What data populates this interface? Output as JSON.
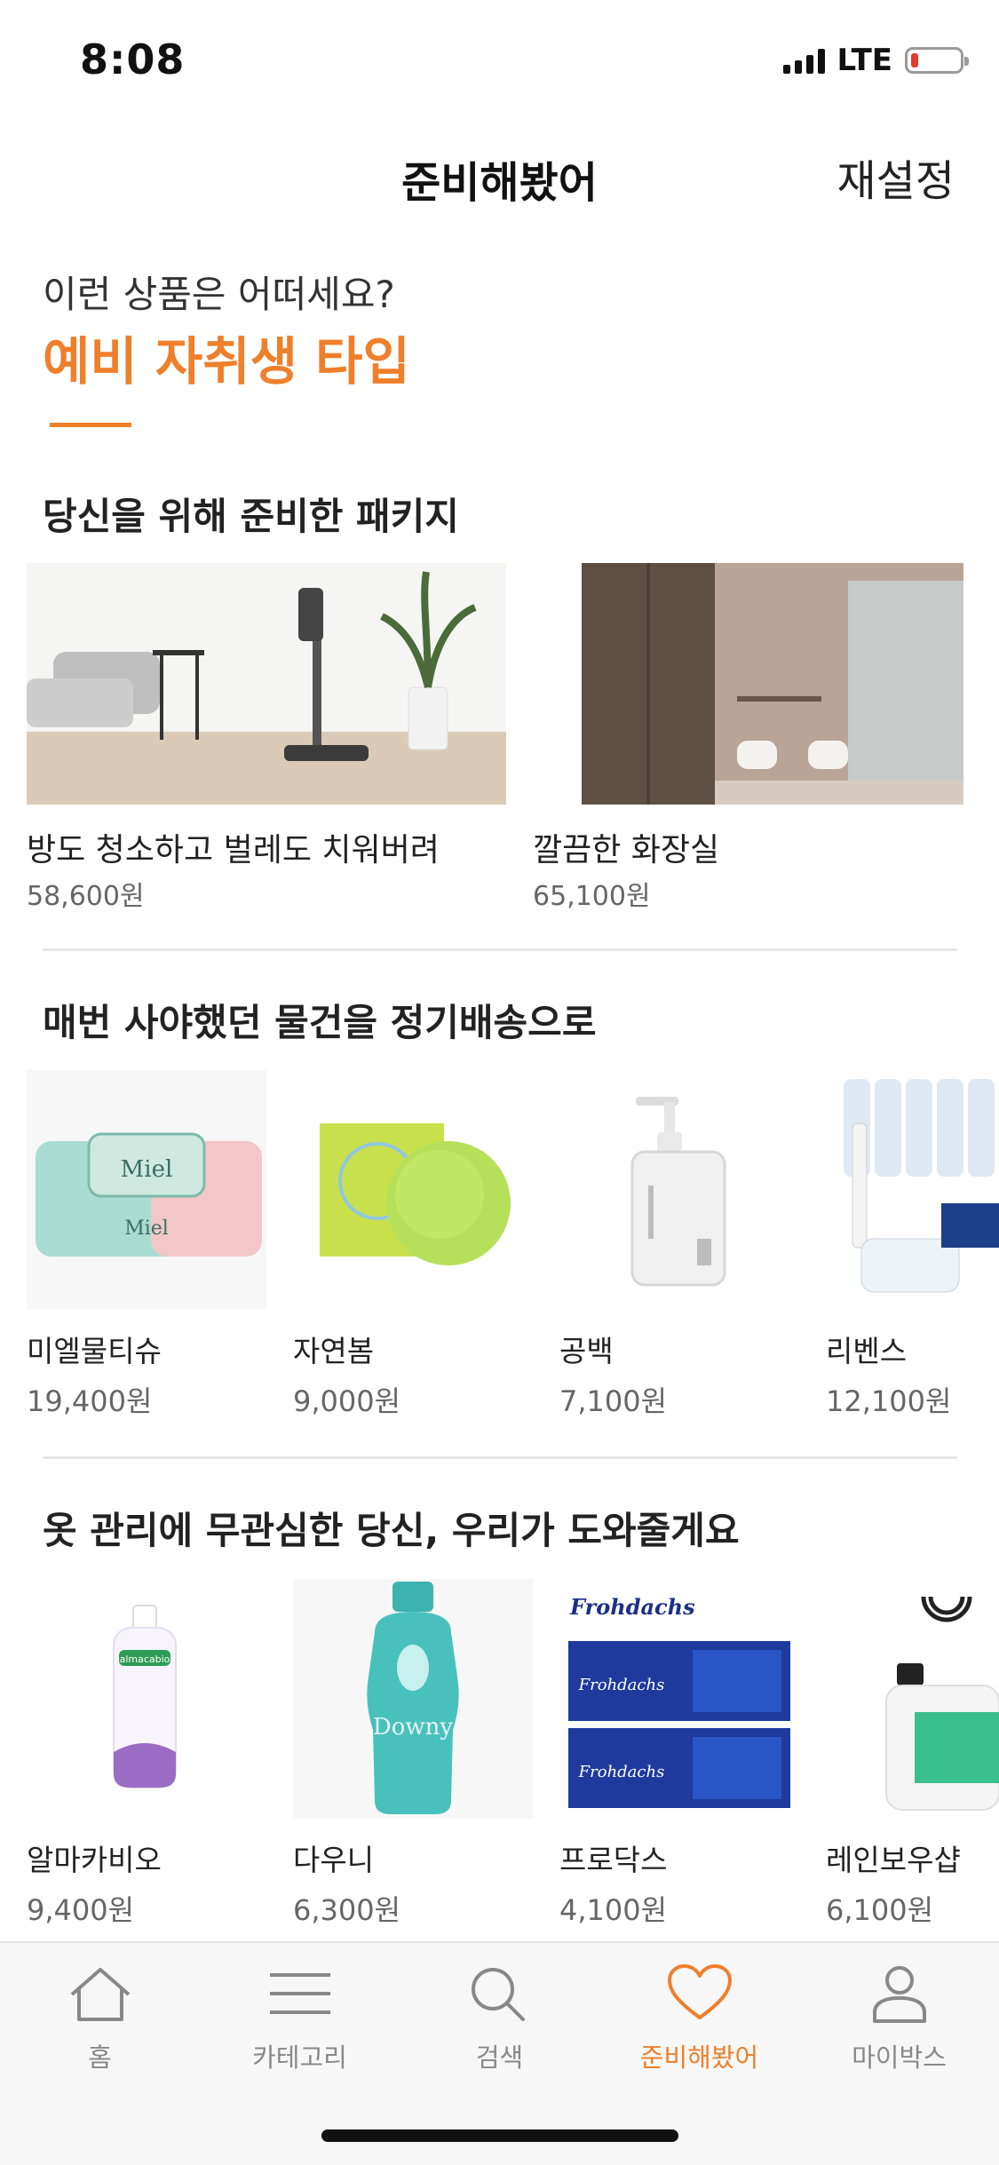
{
  "status_bar": {
    "time": "8:08",
    "network": "LTE"
  },
  "header": {
    "title": "준비해봤어",
    "reset_label": "재설정"
  },
  "intro": {
    "question": "이런 상품은 어떠세요?",
    "type_label": "예비 자취생 타입"
  },
  "colors": {
    "accent": "#ef7f2b"
  },
  "sections": {
    "packages": {
      "title": "당신을 위해 준비한 패키지",
      "items": [
        {
          "name": "방도 청소하고 벌레도 치워버려",
          "price": "58,600원"
        },
        {
          "name": "깔끔한 화장실",
          "price": "65,100원"
        }
      ]
    },
    "subscription": {
      "title": "매번 사야했던 물건을 정기배송으로",
      "items": [
        {
          "name": "미엘물티슈",
          "price": "19,400원"
        },
        {
          "name": "자연봄",
          "price": "9,000원"
        },
        {
          "name": "공백",
          "price": "7,100원"
        },
        {
          "name": "리벤스",
          "price": "12,100원"
        }
      ]
    },
    "laundry": {
      "title": "옷 관리에 무관심한 당신, 우리가 도와줄게요",
      "items": [
        {
          "name": "알마카비오",
          "price": "9,400원"
        },
        {
          "name": "다우니",
          "price": "6,300원"
        },
        {
          "name": "프로닥스",
          "price": "4,100원"
        },
        {
          "name": "레인보우샵",
          "price": "6,100원"
        }
      ]
    }
  },
  "product_image_text": {
    "miel": "Miel",
    "frohdachs": "Frohdachs",
    "downy": "Downy",
    "almacabio": "almacabio"
  },
  "tabs": [
    {
      "label": "홈",
      "icon": "home-icon"
    },
    {
      "label": "카테고리",
      "icon": "menu-icon"
    },
    {
      "label": "검색",
      "icon": "search-icon"
    },
    {
      "label": "준비해봤어",
      "icon": "heart-icon",
      "active": true
    },
    {
      "label": "마이박스",
      "icon": "person-icon"
    }
  ]
}
